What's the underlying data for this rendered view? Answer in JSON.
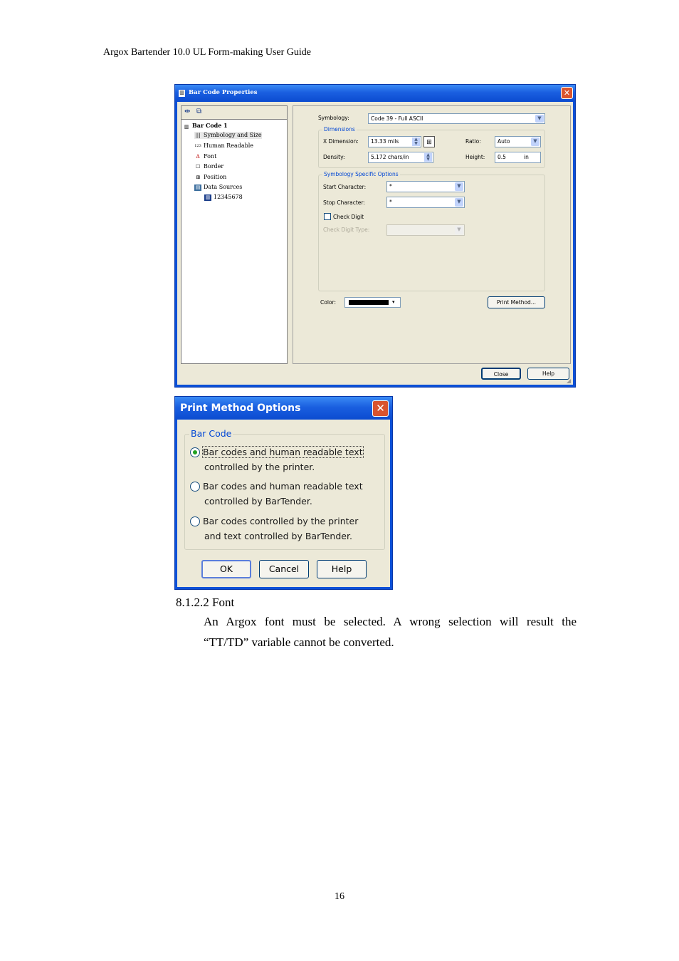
{
  "page": {
    "header": "Argox Bartender 10.0 UL Form-making User Guide",
    "page_number": "16"
  },
  "barcode_dialog": {
    "title": "Bar Code Properties",
    "tree": [
      {
        "label": "Bar Code 1",
        "icon": "barcode-icon"
      },
      {
        "label": "Symbology and Size",
        "icon": "barcode-small-icon"
      },
      {
        "label": "Human Readable",
        "icon": "numbers-icon"
      },
      {
        "label": "Font",
        "icon": "font-icon"
      },
      {
        "label": "Border",
        "icon": "border-icon"
      },
      {
        "label": "Position",
        "icon": "position-icon"
      },
      {
        "label": "Data Sources",
        "icon": "datasource-icon"
      },
      {
        "label": "12345678",
        "icon": "barcode-data-icon"
      }
    ],
    "symbology_label": "Symbology:",
    "symbology_value": "Code 39 - Full ASCII",
    "dimensions_title": "Dimensions",
    "x_dimension_label": "X Dimension:",
    "x_dimension_value": "13.33 mils",
    "ratio_label": "Ratio:",
    "ratio_value": "Auto",
    "density_label": "Density:",
    "density_value": "5.172 chars/in",
    "height_label": "Height:",
    "height_value": "0.5",
    "height_unit": "in",
    "specific_title": "Symbology Specific Options",
    "start_char_label": "Start Character:",
    "start_char_value": "*",
    "stop_char_label": "Stop Character:",
    "stop_char_value": "*",
    "check_digit_label": "Check Digit",
    "check_digit_checked": false,
    "check_digit_type_label": "Check Digit Type:",
    "check_digit_type_value": "",
    "color_label": "Color:",
    "color_value": "#000000",
    "print_method_button": "Print Method...",
    "close_button": "Close",
    "help_button": "Help"
  },
  "print_method_dialog": {
    "title": "Print Method Options",
    "group_title": "Bar Code",
    "options": [
      {
        "line1": "Bar codes and human readable text",
        "line2": "controlled by the printer.",
        "selected": true
      },
      {
        "line1": "Bar codes and human readable text",
        "line2": "controlled by BarTender.",
        "selected": false
      },
      {
        "line1": "Bar codes controlled by the printer",
        "line2": "and text controlled by BarTender.",
        "selected": false
      }
    ],
    "ok_button": "OK",
    "cancel_button": "Cancel",
    "help_button": "Help"
  },
  "section": {
    "heading": "8.1.2.2 Font",
    "body_line1": "An Argox font must be selected. A wrong selection will result the",
    "body_line2": "“TT/TD” variable cannot be converted."
  }
}
